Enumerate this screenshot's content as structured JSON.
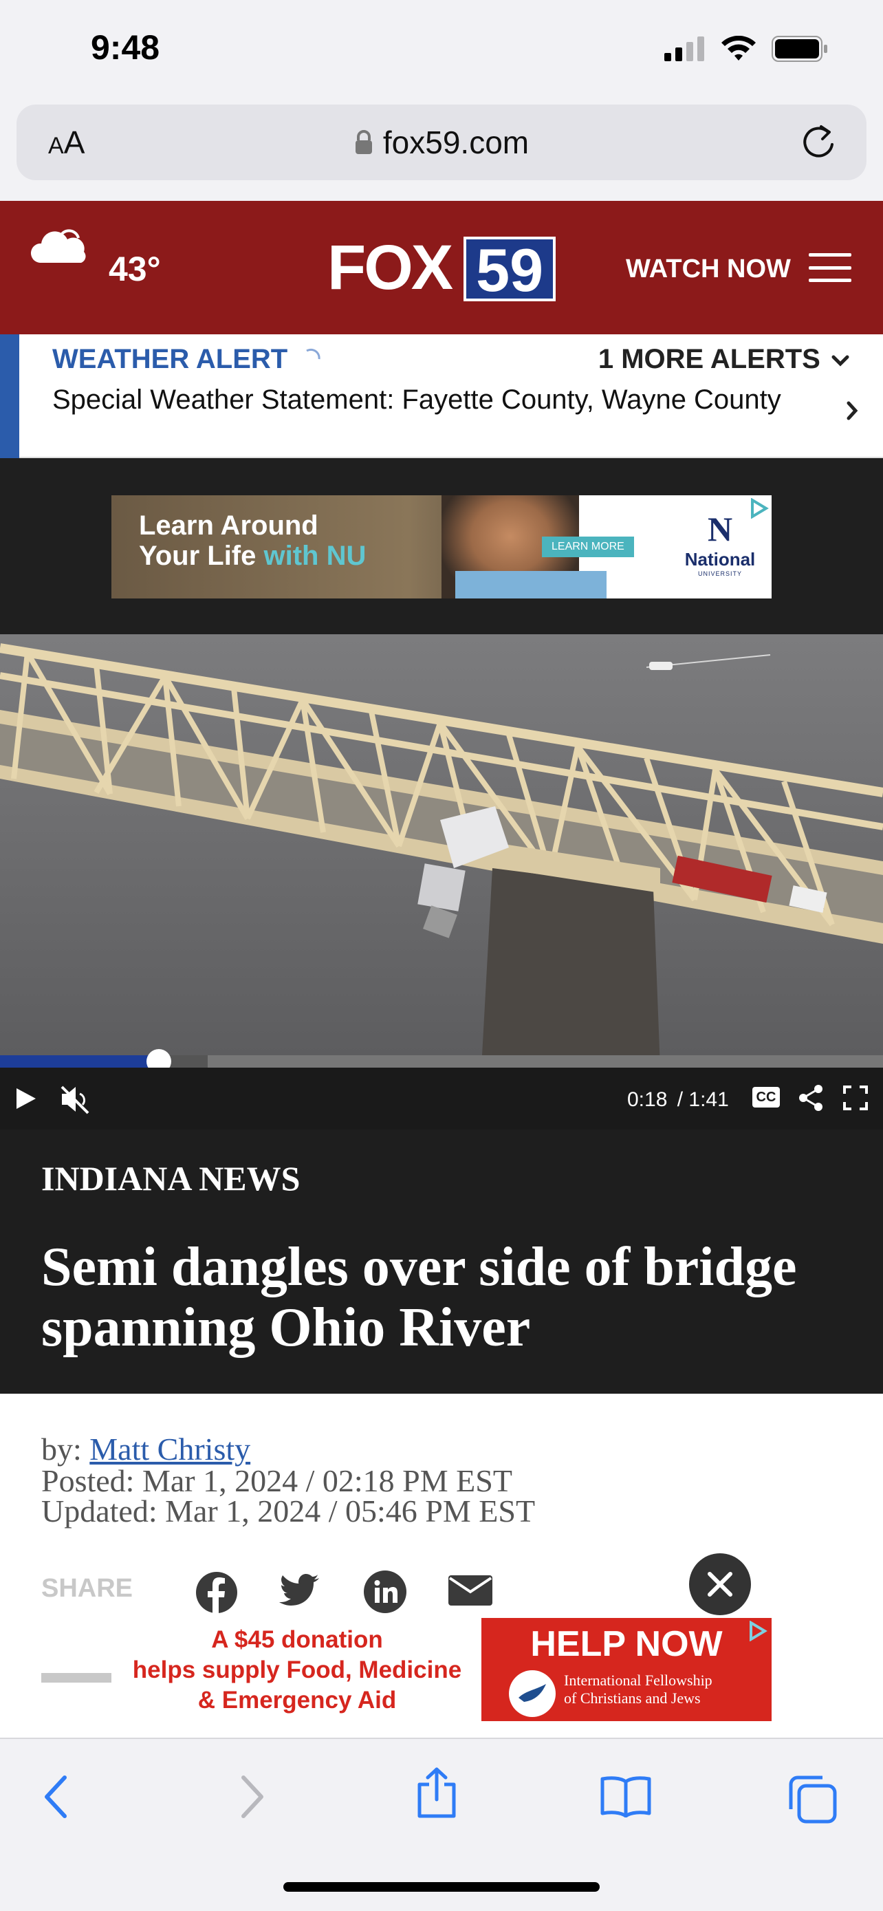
{
  "status_bar": {
    "time": "9:48"
  },
  "url_bar": {
    "aa_label_small": "A",
    "aa_label_large": "A",
    "host": "fox59.com"
  },
  "header": {
    "temperature": "43°",
    "logo_fox": "FOX",
    "logo_number": "59",
    "watch_now": "WATCH NOW",
    "brand_red": "#8c1a1a",
    "brand_blue": "#1d3a8a"
  },
  "alert": {
    "title": "WEATHER ALERT",
    "more": "1 MORE ALERTS",
    "body": "Special Weather Statement: Fayette County, Wayne County",
    "accent": "#2b5cab"
  },
  "top_ad": {
    "line1": "Learn Around",
    "line2_prefix": "Your Life ",
    "line2_highlight": "with NU",
    "cta": "LEARN MORE",
    "brand_logo": "N",
    "brand_name": "National",
    "brand_sub": "UNIVERSITY"
  },
  "video": {
    "current_time": "0:18",
    "duration": "/ 1:41",
    "progress": 0.18,
    "buffered": 0.235,
    "cc_label": "CC"
  },
  "article": {
    "category": "INDIANA NEWS",
    "headline": "Semi dangles over side of bridge spanning Ohio River",
    "by_label": "by: ",
    "author": "Matt Christy",
    "posted": "Posted: Mar 1, 2024 / 02:18 PM EST",
    "updated": "Updated: Mar 1, 2024 / 05:46 PM EST",
    "share_label": "SHARE"
  },
  "bottom_ad": {
    "line1": "A $45 donation",
    "line2": "helps supply Food, Medicine",
    "line3": "& Emergency Aid",
    "help_now": "HELP NOW",
    "org_line1": "International Fellowship",
    "org_line2": "of Christians and Jews"
  },
  "icons": {
    "weather": "partly-cloudy-icon",
    "lock": "lock-icon",
    "reload": "reload-icon",
    "menu": "hamburger-menu-icon",
    "play": "play-icon",
    "mute": "muted-speaker-icon",
    "share": "share-icon",
    "fullscreen": "fullscreen-icon",
    "toolbar": [
      "back-icon",
      "forward-icon",
      "share-icon",
      "bookmarks-icon",
      "tabs-icon"
    ]
  }
}
